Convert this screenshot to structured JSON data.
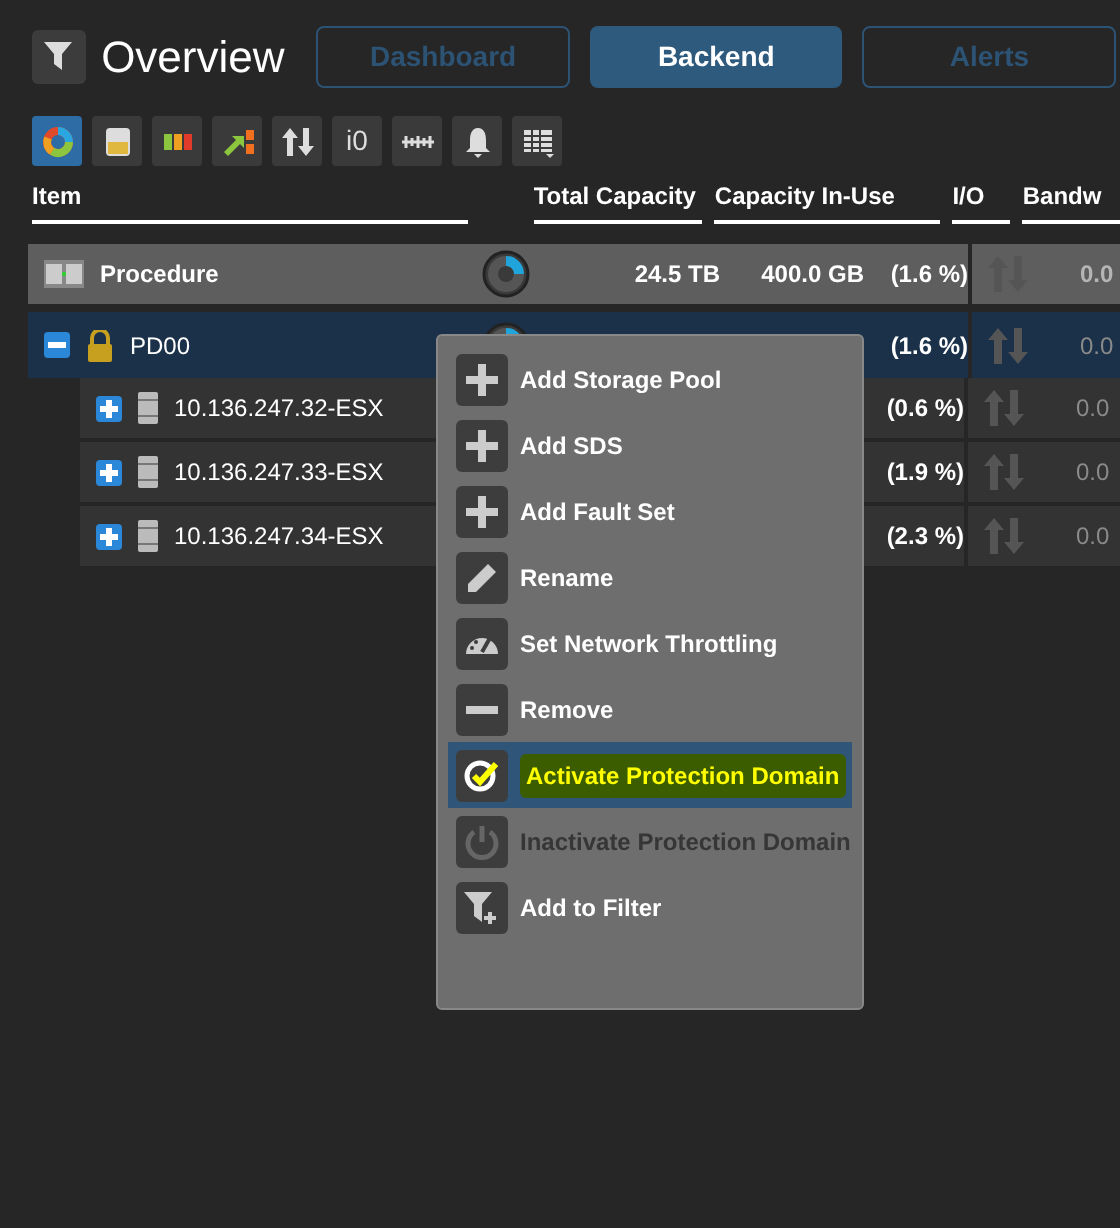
{
  "header": {
    "title": "Overview"
  },
  "tabs": [
    {
      "label": "Dashboard",
      "selected": false
    },
    {
      "label": "Backend",
      "selected": true
    },
    {
      "label": "Alerts",
      "selected": false
    }
  ],
  "toolbar": [
    {
      "kind": "donut",
      "selected": true
    },
    {
      "kind": "gauge",
      "selected": false
    },
    {
      "kind": "bars",
      "selected": false
    },
    {
      "kind": "flow",
      "selected": false
    },
    {
      "kind": "arrows",
      "selected": false
    },
    {
      "kind": "io",
      "label": "i0",
      "selected": false
    },
    {
      "kind": "ruler",
      "selected": false
    },
    {
      "kind": "bell",
      "selected": false
    },
    {
      "kind": "grid",
      "selected": false
    }
  ],
  "table": {
    "columns": [
      "Item",
      "Total Capacity",
      "Capacity In-Use",
      "I/O",
      "Bandw"
    ],
    "rows": [
      {
        "kind": "system",
        "name": "Procedure",
        "total": "24.5 TB",
        "in_use": "400.0 GB",
        "percent": "(1.6 %)",
        "bandwidth": "0.0"
      },
      {
        "kind": "domain",
        "name": "PD00",
        "expanded": true,
        "percent": "(1.6 %)",
        "bandwidth": "0.0",
        "selected": true,
        "children": [
          {
            "kind": "sds",
            "name": "10.136.247.32-ESX",
            "expanded": false,
            "percent": "(0.6 %)",
            "bandwidth": "0.0"
          },
          {
            "kind": "sds",
            "name": "10.136.247.33-ESX",
            "expanded": false,
            "percent": "(1.9 %)",
            "bandwidth": "0.0"
          },
          {
            "kind": "sds",
            "name": "10.136.247.34-ESX",
            "expanded": false,
            "percent": "(2.3 %)",
            "bandwidth": "0.0"
          }
        ]
      }
    ]
  },
  "context_menu": [
    {
      "kind": "plus",
      "label": "Add Storage Pool",
      "selected": false,
      "disabled": false
    },
    {
      "kind": "plus",
      "label": "Add SDS",
      "selected": false,
      "disabled": false
    },
    {
      "kind": "plus",
      "label": "Add Fault Set",
      "selected": false,
      "disabled": false
    },
    {
      "kind": "pencil",
      "label": "Rename",
      "selected": false,
      "disabled": false
    },
    {
      "kind": "gauge",
      "label": "Set Network Throttling",
      "selected": false,
      "disabled": false
    },
    {
      "kind": "minus",
      "label": "Remove",
      "selected": false,
      "disabled": false
    },
    {
      "kind": "check",
      "label": "Activate Protection Domain",
      "selected": true,
      "disabled": false
    },
    {
      "kind": "power",
      "label": "Inactivate Protection Domain",
      "selected": false,
      "disabled": true
    },
    {
      "kind": "filter",
      "label": "Add to Filter",
      "selected": false,
      "disabled": false
    }
  ]
}
